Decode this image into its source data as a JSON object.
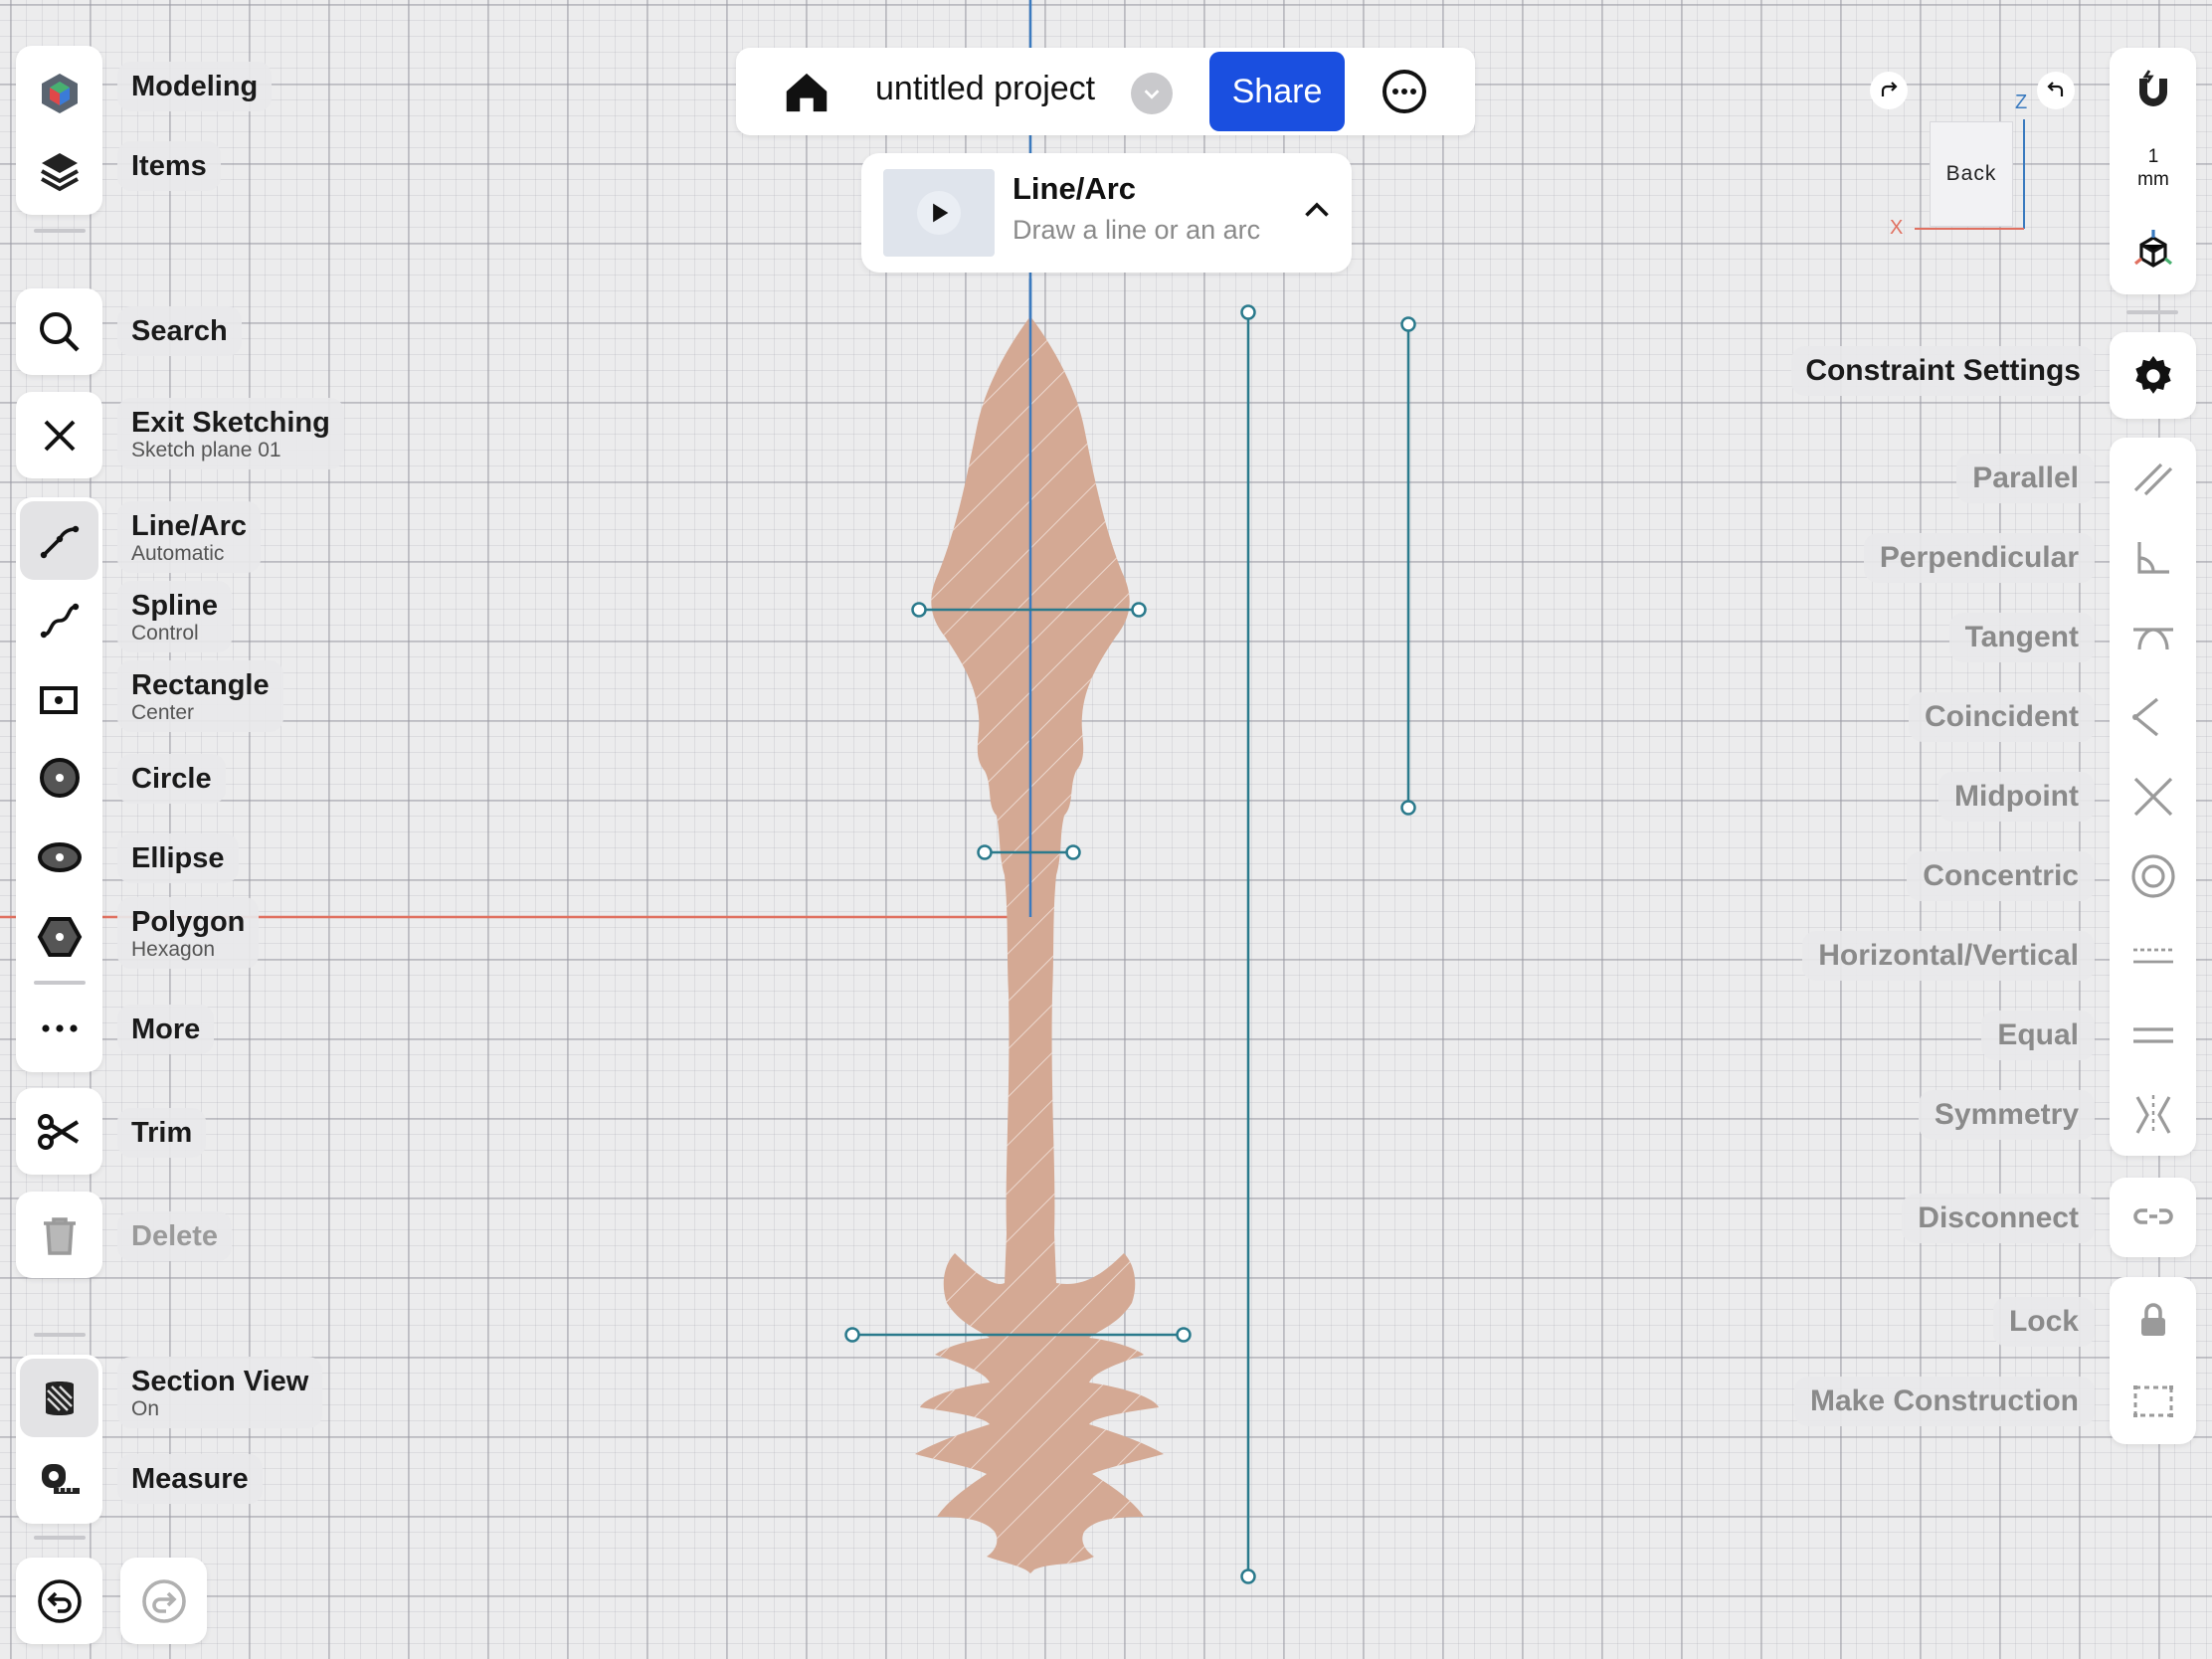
{
  "header": {
    "project_name": "untitled project",
    "share_label": "Share"
  },
  "tool_tip": {
    "title": "Line/Arc",
    "subtitle": "Draw a line or an arc"
  },
  "left_toolbar": {
    "modeling": "Modeling",
    "items": "Items",
    "search": "Search",
    "exit_sketching": "Exit Sketching",
    "exit_sub": "Sketch plane 01",
    "line_arc": "Line/Arc",
    "line_arc_sub": "Automatic",
    "spline": "Spline",
    "spline_sub": "Control",
    "rectangle": "Rectangle",
    "rectangle_sub": "Center",
    "circle": "Circle",
    "ellipse": "Ellipse",
    "polygon": "Polygon",
    "polygon_sub": "Hexagon",
    "more": "More",
    "trim": "Trim",
    "delete": "Delete",
    "section_view": "Section View",
    "section_sub": "On",
    "measure": "Measure"
  },
  "view_cube": {
    "face_label": "Back",
    "axis_x": "X",
    "axis_z": "Z"
  },
  "grid_scale": {
    "value": "1",
    "unit": "mm"
  },
  "constraints": {
    "settings": "Constraint Settings",
    "parallel": "Parallel",
    "perpendicular": "Perpendicular",
    "tangent": "Tangent",
    "coincident": "Coincident",
    "midpoint": "Midpoint",
    "concentric": "Concentric",
    "horizontal_vertical": "Horizontal/Vertical",
    "equal": "Equal",
    "symmetry": "Symmetry",
    "disconnect": "Disconnect",
    "lock": "Lock",
    "make_construction": "Make Construction"
  },
  "colors": {
    "accent": "#1a4fe0",
    "sketch_fill": "#d4a994",
    "sketch_line": "#2a7a8c",
    "x_axis": "#e07060",
    "y_axis": "#3a7abf"
  }
}
